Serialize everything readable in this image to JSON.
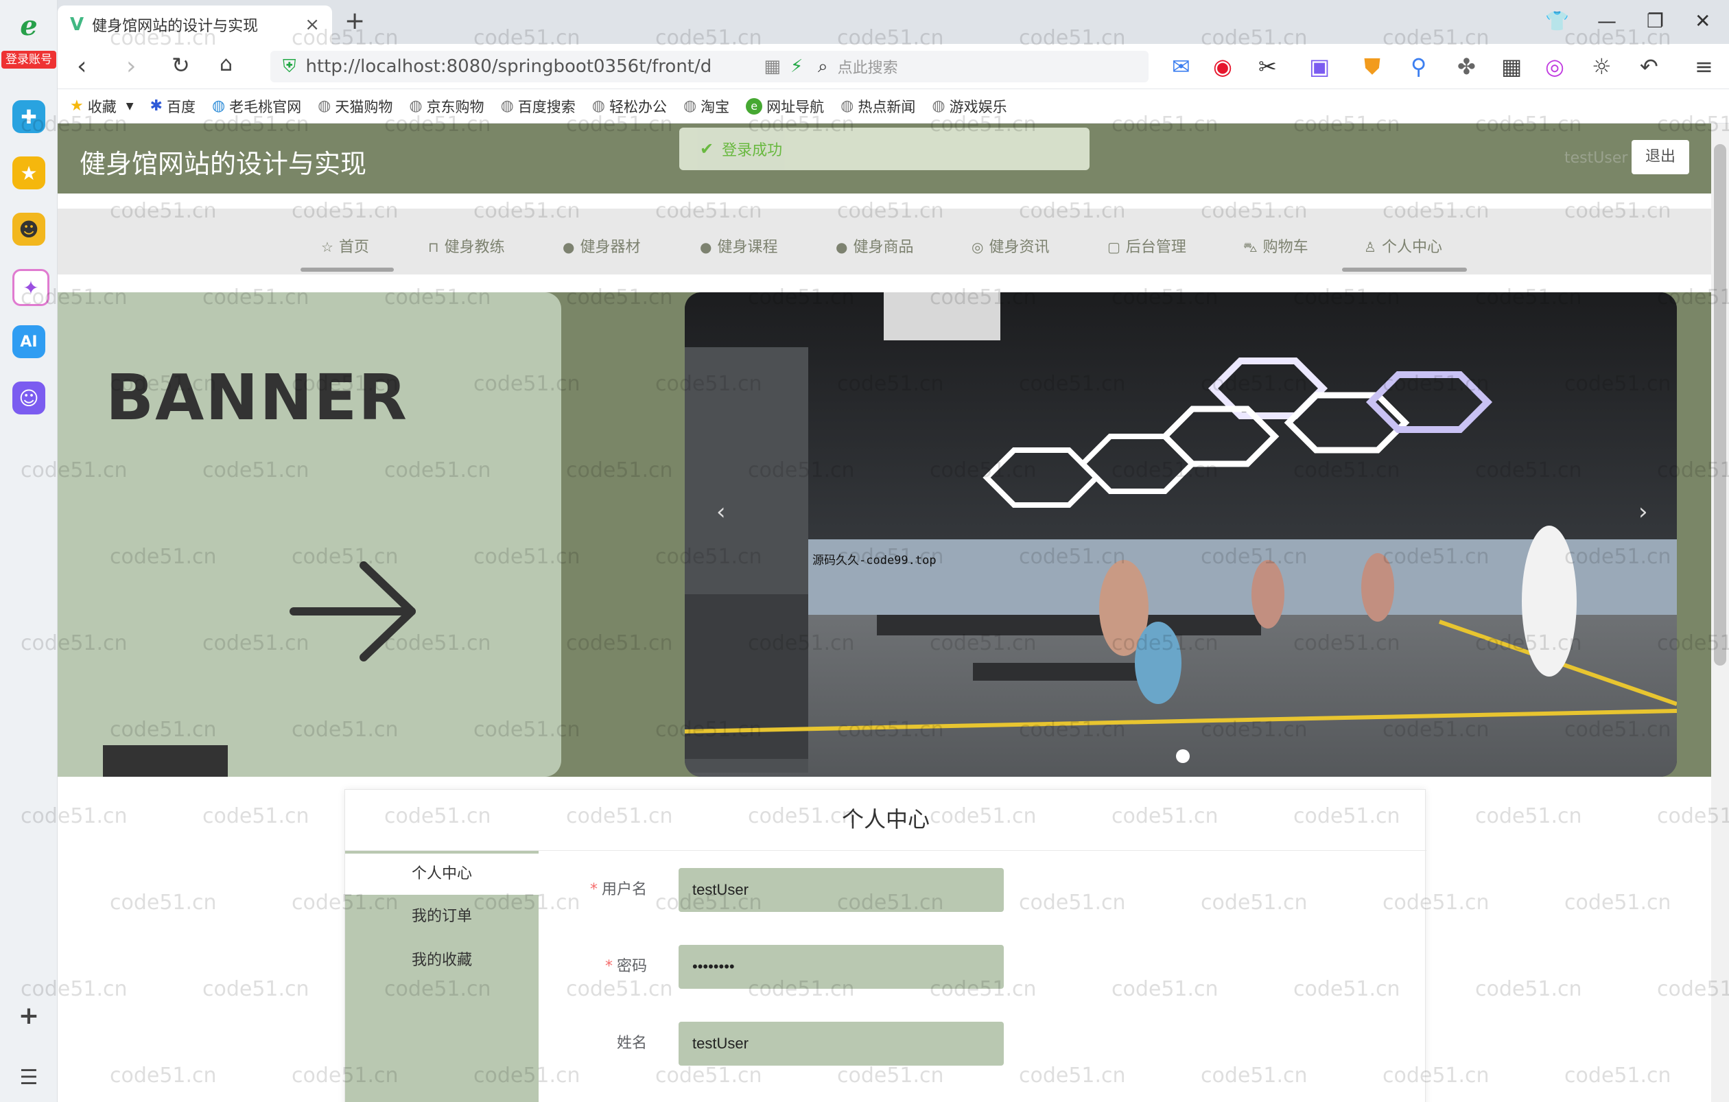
{
  "browser": {
    "tab_title": "健身馆网站的设计与实现",
    "url": "http://localhost:8080/springboot0356t/front/d",
    "search_placeholder": "点此搜索",
    "rail_badge": "登录账号",
    "rail_ai_label": "AI"
  },
  "bookmarks": [
    "收藏",
    "百度",
    "老毛桃官网",
    "天猫购物",
    "京东购物",
    "百度搜索",
    "轻松办公",
    "淘宝",
    "网址导航",
    "热点新闻",
    "游戏娱乐"
  ],
  "header": {
    "site_title": "健身馆网站的设计与实现",
    "toast": "登录成功",
    "user_name": "testUser",
    "logout_label": "退出"
  },
  "nav": [
    {
      "label": "首页",
      "icon": "star-icon"
    },
    {
      "label": "健身教练",
      "icon": "bag-icon"
    },
    {
      "label": "健身器材",
      "icon": "info-icon"
    },
    {
      "label": "健身课程",
      "icon": "question-icon"
    },
    {
      "label": "健身商品",
      "icon": "info-icon"
    },
    {
      "label": "健身资讯",
      "icon": "target-icon"
    },
    {
      "label": "后台管理",
      "icon": "clipboard-icon"
    },
    {
      "label": "购物车",
      "icon": "cart-icon"
    },
    {
      "label": "个人中心",
      "icon": "user-icon"
    }
  ],
  "banner": {
    "word": "BANNER",
    "photo_caption": "源码久久-code99.top"
  },
  "panel": {
    "title": "个人中心",
    "menu": [
      "个人中心",
      "我的订单",
      "我的收藏"
    ],
    "fields": [
      {
        "label": "用户名",
        "required": true,
        "value": "testUser"
      },
      {
        "label": "密码",
        "required": true,
        "value": "••••••••"
      },
      {
        "label": "姓名",
        "required": false,
        "value": "testUser"
      }
    ]
  },
  "watermark": "code51.cn",
  "colors": {
    "header_bg": "#7a8667",
    "panel_green": "#b9c8b1",
    "toast_text": "#67c23a"
  }
}
